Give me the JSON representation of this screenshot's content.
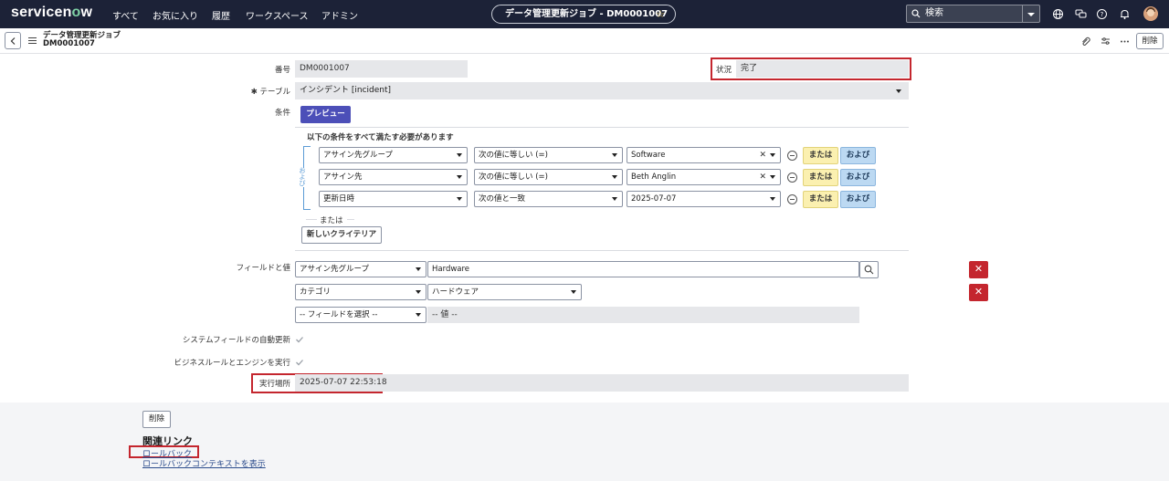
{
  "nav": {
    "logo_pre": "servicen",
    "logo_o": "o",
    "logo_post": "w",
    "items": [
      "すべて",
      "お気に入り",
      "履歴",
      "ワークスペース",
      "アドミン"
    ],
    "record_title": "データ管理更新ジョブ - DM0001007",
    "search_label": "検索"
  },
  "header": {
    "title_line1": "データ管理更新ジョブ",
    "title_line2": "DM0001007",
    "delete_label": "削除"
  },
  "form": {
    "number_label": "番号",
    "number_value": "DM0001007",
    "status_label": "状況",
    "status_value": "完了",
    "table_required": "✱",
    "table_label": "テーブル",
    "table_value": "インシデント [incident]",
    "condition_label": "条件",
    "preview_button": "プレビュー",
    "condition_heading": "以下の条件をすべて満たす必要があります",
    "and_group_label": "および",
    "conditions": [
      {
        "field": "アサイン先グループ",
        "operator": "次の値に等しい (=)",
        "value": "Software",
        "clearable": true
      },
      {
        "field": "アサイン先",
        "operator": "次の値に等しい (=)",
        "value": "Beth Anglin",
        "clearable": true
      },
      {
        "field": "更新日時",
        "operator": "次の値と一致",
        "value": "2025-07-07",
        "clearable": false
      }
    ],
    "or_button": "または",
    "and_button": "および",
    "or_separator": "または",
    "new_criteria_button": "新しいクライテリア",
    "fields_label": "フィールドと値",
    "field_rows": [
      {
        "field": "アサイン先グループ",
        "value": "Hardware"
      },
      {
        "field": "カテゴリ",
        "value": "ハードウェア"
      },
      {
        "field": "-- フィールドを選択 --",
        "value": "-- 値 --"
      }
    ],
    "auto_update_label": "システムフィールドの自動更新",
    "run_rules_label": "ビジネスルールとエンジンを実行",
    "run_at_label": "実行場所",
    "run_at_value": "2025-07-07 22:53:18"
  },
  "footer": {
    "delete_label": "削除",
    "related_links_heading": "関連リンク",
    "links": [
      "ロールバック",
      "ロールバックコンテキストを表示"
    ]
  },
  "colors": {
    "nav_bg": "#1c2237",
    "accent_button": "#4c4fb8",
    "highlight_red": "#c4262e",
    "or_button": "#fbf0b0",
    "and_button": "#bcd9f2"
  }
}
